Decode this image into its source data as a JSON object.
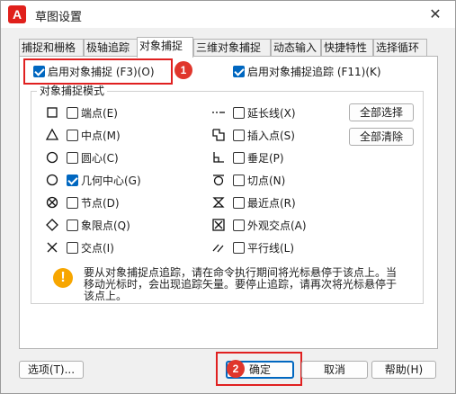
{
  "window": {
    "app_icon_letter": "A",
    "title": "草图设置",
    "close_glyph": "✕"
  },
  "tabs": [
    {
      "label": "捕捉和栅格",
      "active": false
    },
    {
      "label": "极轴追踪",
      "active": false
    },
    {
      "label": "对象捕捉",
      "active": true
    },
    {
      "label": "三维对象捕捉",
      "active": false
    },
    {
      "label": "动态输入",
      "active": false
    },
    {
      "label": "快捷特性",
      "active": false
    },
    {
      "label": "选择循环",
      "active": false
    }
  ],
  "osnap_on": {
    "label": "启用对象捕捉 (F3)(O)",
    "checked": true
  },
  "tracking_on": {
    "label": "启用对象捕捉追踪 (F11)(K)",
    "checked": true
  },
  "group_title": "对象捕捉模式",
  "modes_left": [
    {
      "label": "端点(E)",
      "checked": false,
      "icon": "square-endpoint-icon"
    },
    {
      "label": "中点(M)",
      "checked": false,
      "icon": "triangle-midpoint-icon"
    },
    {
      "label": "圆心(C)",
      "checked": false,
      "icon": "circle-center-icon"
    },
    {
      "label": "几何中心(G)",
      "checked": true,
      "icon": "circle-geometric-center-icon"
    },
    {
      "label": "节点(D)",
      "checked": false,
      "icon": "node-icon"
    },
    {
      "label": "象限点(Q)",
      "checked": false,
      "icon": "diamond-quadrant-icon"
    },
    {
      "label": "交点(I)",
      "checked": false,
      "icon": "x-intersection-icon"
    }
  ],
  "modes_right": [
    {
      "label": "延长线(X)",
      "checked": false,
      "icon": "extension-icon"
    },
    {
      "label": "插入点(S)",
      "checked": false,
      "icon": "insertion-icon"
    },
    {
      "label": "垂足(P)",
      "checked": false,
      "icon": "perpendicular-icon"
    },
    {
      "label": "切点(N)",
      "checked": false,
      "icon": "tangent-icon"
    },
    {
      "label": "最近点(R)",
      "checked": false,
      "icon": "nearest-icon"
    },
    {
      "label": "外观交点(A)",
      "checked": false,
      "icon": "apparent-intersection-icon"
    },
    {
      "label": "平行线(L)",
      "checked": false,
      "icon": "parallel-icon"
    }
  ],
  "buttons": {
    "select_all": "全部选择",
    "clear_all": "全部清除",
    "options": "选项(T)...",
    "ok": "确定",
    "cancel": "取消",
    "help": "帮助(H)"
  },
  "info": {
    "icon_glyph": "!",
    "text": "要从对象捕捉点追踪，请在命令执行期间将光标悬停于该点上。当移动光标时，会出现追踪矢量。要停止追踪，请再次将光标悬停于该点上。"
  },
  "badges": [
    "1",
    "2"
  ],
  "colors": {
    "accent": "#0067c0",
    "annotation_red": "#e02020",
    "warning": "#f7a600"
  }
}
